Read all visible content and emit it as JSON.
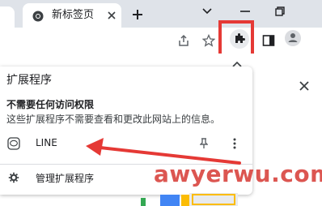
{
  "browser": {
    "tab": {
      "title": "新标签页",
      "favicon": "chrome-icon",
      "close": "close-icon"
    },
    "new_tab": "plus-icon",
    "window_controls": [
      "chevron-down-icon",
      "minimize-icon",
      "restore-icon"
    ],
    "toolbar_icons": [
      "share-icon",
      "star-icon",
      "puzzle-icon",
      "side-panel-icon",
      "profile-icon"
    ]
  },
  "popup": {
    "title": "扩展程序",
    "section_title": "不需要任何访问权限",
    "section_desc": "这些扩展程序不需要查看和更改此网站上的信息。",
    "extensions": [
      {
        "name": "LINE",
        "icon": "line-icon",
        "pin": "pin-icon",
        "more": "more-vert-icon"
      }
    ],
    "manage_label": "管理扩展程序",
    "manage_icon": "gear-icon",
    "close_icon": "close-icon"
  },
  "watermark": "awyerwu.com",
  "colors": {
    "tabstrip": "#dfe3e9",
    "highlight": "#e53935",
    "watermark": "#d9443f",
    "arrow": "#e53935"
  }
}
